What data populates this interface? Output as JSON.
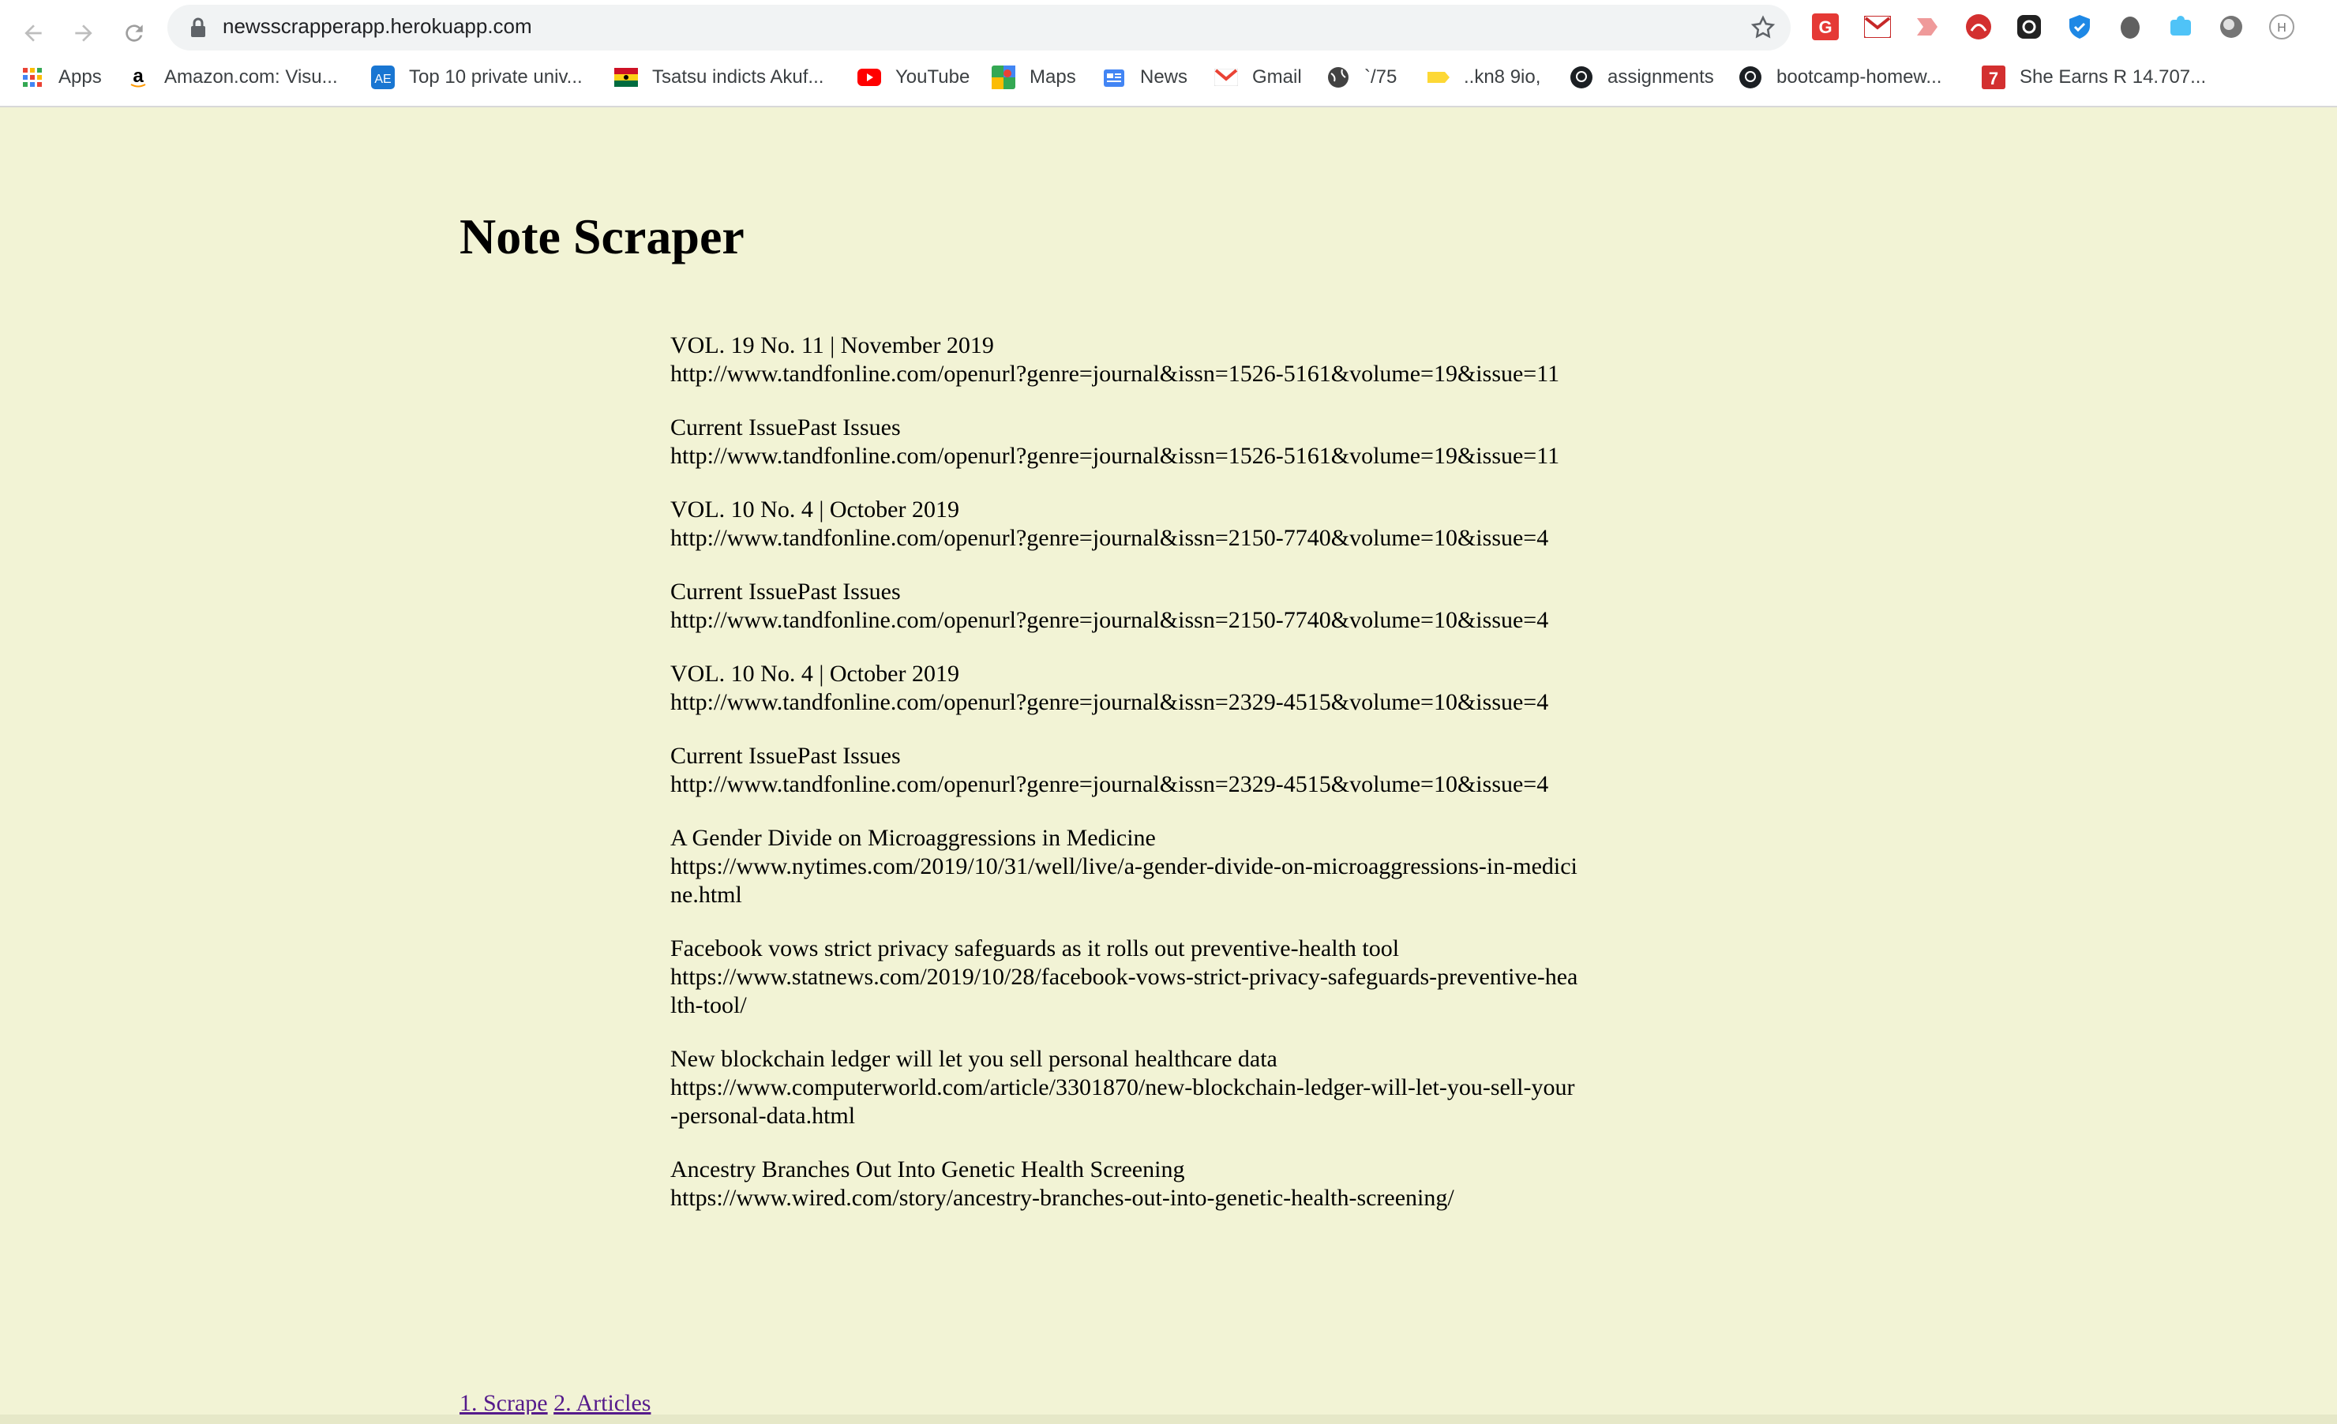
{
  "browser": {
    "url": "newsscrapperapp.herokuapp.com",
    "bookmarks": [
      {
        "label": "Apps",
        "icon": "apps-grid-icon"
      },
      {
        "label": "Amazon.com: Visu...",
        "icon": "amazon-icon"
      },
      {
        "label": "Top 10 private univ...",
        "icon": "university-icon"
      },
      {
        "label": "Tsatsu indicts Akuf...",
        "icon": "flag-icon"
      },
      {
        "label": "YouTube",
        "icon": "youtube-icon"
      },
      {
        "label": "Maps",
        "icon": "maps-icon"
      },
      {
        "label": "News",
        "icon": "news-icon"
      },
      {
        "label": "Gmail",
        "icon": "gmail-icon"
      },
      {
        "label": "`/75",
        "icon": "globe-icon"
      },
      {
        "label": "..kn8 9io,",
        "icon": "tag-icon"
      },
      {
        "label": "assignments",
        "icon": "github-icon"
      },
      {
        "label": "bootcamp-homew...",
        "icon": "github-icon"
      },
      {
        "label": "She Earns R 14.707...",
        "icon": "seven-icon"
      }
    ]
  },
  "page": {
    "title": "Note Scraper",
    "articles": [
      {
        "headline": "VOL. 19 No. 11 | November 2019",
        "url": "http://www.tandfonline.com/openurl?genre=journal&issn=1526-5161&volume=19&issue=11"
      },
      {
        "headline": "Current IssuePast Issues",
        "url": "http://www.tandfonline.com/openurl?genre=journal&issn=1526-5161&volume=19&issue=11"
      },
      {
        "headline": "VOL. 10 No. 4 | October 2019",
        "url": "http://www.tandfonline.com/openurl?genre=journal&issn=2150-7740&volume=10&issue=4"
      },
      {
        "headline": "Current IssuePast Issues",
        "url": "http://www.tandfonline.com/openurl?genre=journal&issn=2150-7740&volume=10&issue=4"
      },
      {
        "headline": "VOL. 10 No. 4 | October 2019",
        "url": "http://www.tandfonline.com/openurl?genre=journal&issn=2329-4515&volume=10&issue=4"
      },
      {
        "headline": "Current IssuePast Issues",
        "url": "http://www.tandfonline.com/openurl?genre=journal&issn=2329-4515&volume=10&issue=4"
      },
      {
        "headline": "A Gender Divide on Microaggressions in Medicine",
        "url": "https://www.nytimes.com/2019/10/31/well/live/a-gender-divide-on-microaggressions-in-medicine.html"
      },
      {
        "headline": "Facebook vows strict privacy safeguards as it rolls out preventive-health tool",
        "url": "https://www.statnews.com/2019/10/28/facebook-vows-strict-privacy-safeguards-preventive-health-tool/"
      },
      {
        "headline": "New blockchain ledger will let you sell personal healthcare data",
        "url": "https://www.computerworld.com/article/3301870/new-blockchain-ledger-will-let-you-sell-your-personal-data.html"
      },
      {
        "headline": "Ancestry Branches Out Into Genetic Health Screening",
        "url": "https://www.wired.com/story/ancestry-branches-out-into-genetic-health-screening/"
      }
    ],
    "footer_links": [
      "1. Scrape",
      "2. Articles"
    ]
  },
  "colors": {
    "page_background": "#f2f3d5",
    "visited_link": "#551a8b"
  }
}
